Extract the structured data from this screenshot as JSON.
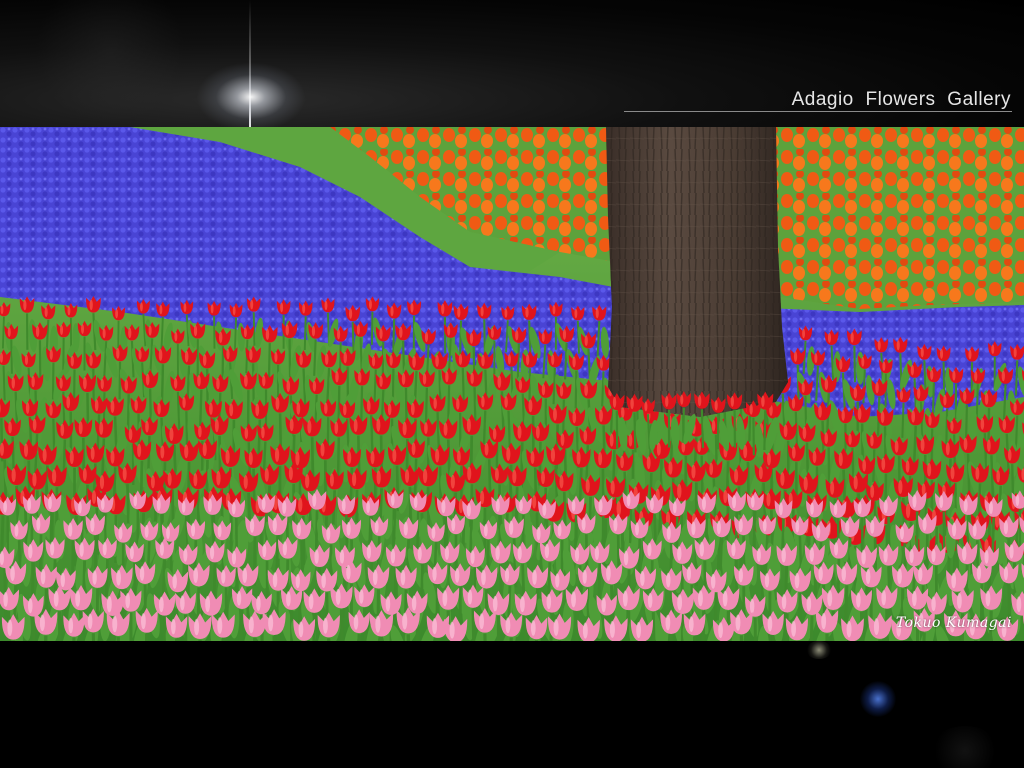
{
  "header": {
    "title": "Adagio  Flowers  Gallery"
  },
  "photo": {
    "signature": "Tokuo Kumagai",
    "signature_icon": "signature-mark",
    "colors": {
      "muscari_blue": "#4a44d8",
      "red_tulip": "#e0141c",
      "pink_tulip": "#f08cb4",
      "orange_tulip": "#f06018",
      "grass_green": "#4f9a36",
      "trunk_brown": "#4a3a30"
    }
  },
  "decor": {
    "flare_icon": "lens-flare",
    "bokeh_icon": "bokeh-dots"
  }
}
